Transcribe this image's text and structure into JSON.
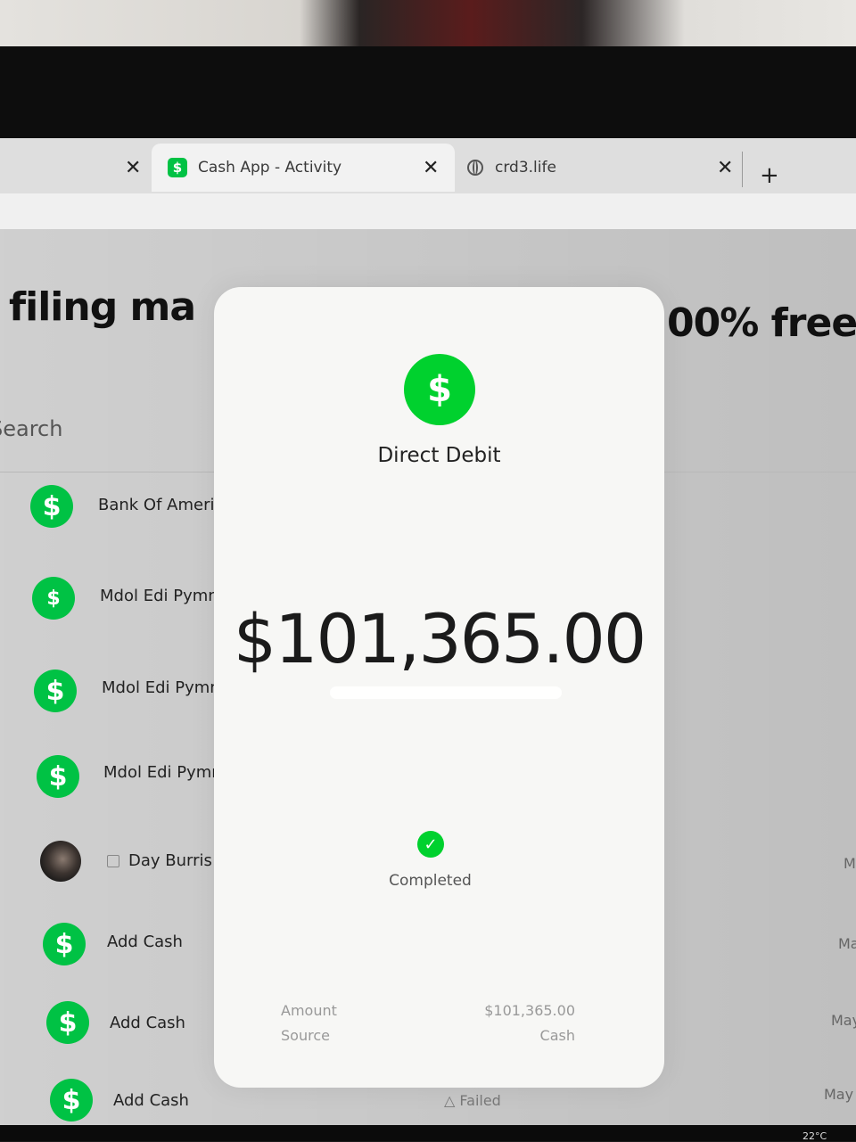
{
  "browser": {
    "tabs": [
      {
        "title": ""
      },
      {
        "title": "Cash App - Activity",
        "favicon": "$"
      },
      {
        "title": "crd3.life"
      }
    ],
    "close_glyph": "✕",
    "new_tab_glyph": "+"
  },
  "page": {
    "banner_left": "filing ma",
    "banner_right": "00% free",
    "search_placeholder": "Search",
    "rows": [
      {
        "name": "Bank Of Ameri",
        "icon": "$",
        "date": ""
      },
      {
        "name": "Mdol Edi Pymn",
        "icon": "$",
        "date": ""
      },
      {
        "name": "Mdol Edi Pymn",
        "icon": "$",
        "date": ""
      },
      {
        "name": "Mdol Edi Pymn",
        "icon": "$",
        "date": ""
      },
      {
        "name": "Day Burris",
        "icon": "avatar",
        "date": "M"
      },
      {
        "name": "Add Cash",
        "icon": "$",
        "date": "Ma"
      },
      {
        "name": "Add Cash",
        "icon": "$",
        "date": "May"
      },
      {
        "name": "Add Cash",
        "icon": "$",
        "date": "May"
      }
    ],
    "failed_label": "Failed"
  },
  "modal": {
    "icon": "$",
    "title": "Direct Debit",
    "amount": "$101,365.00",
    "status": "Completed",
    "details": [
      {
        "label": "Amount",
        "value": "$101,365.00"
      },
      {
        "label": "Source",
        "value": "Cash"
      }
    ]
  },
  "taskbar": {
    "status": "22°C"
  },
  "colors": {
    "cash_green": "#00c244"
  }
}
